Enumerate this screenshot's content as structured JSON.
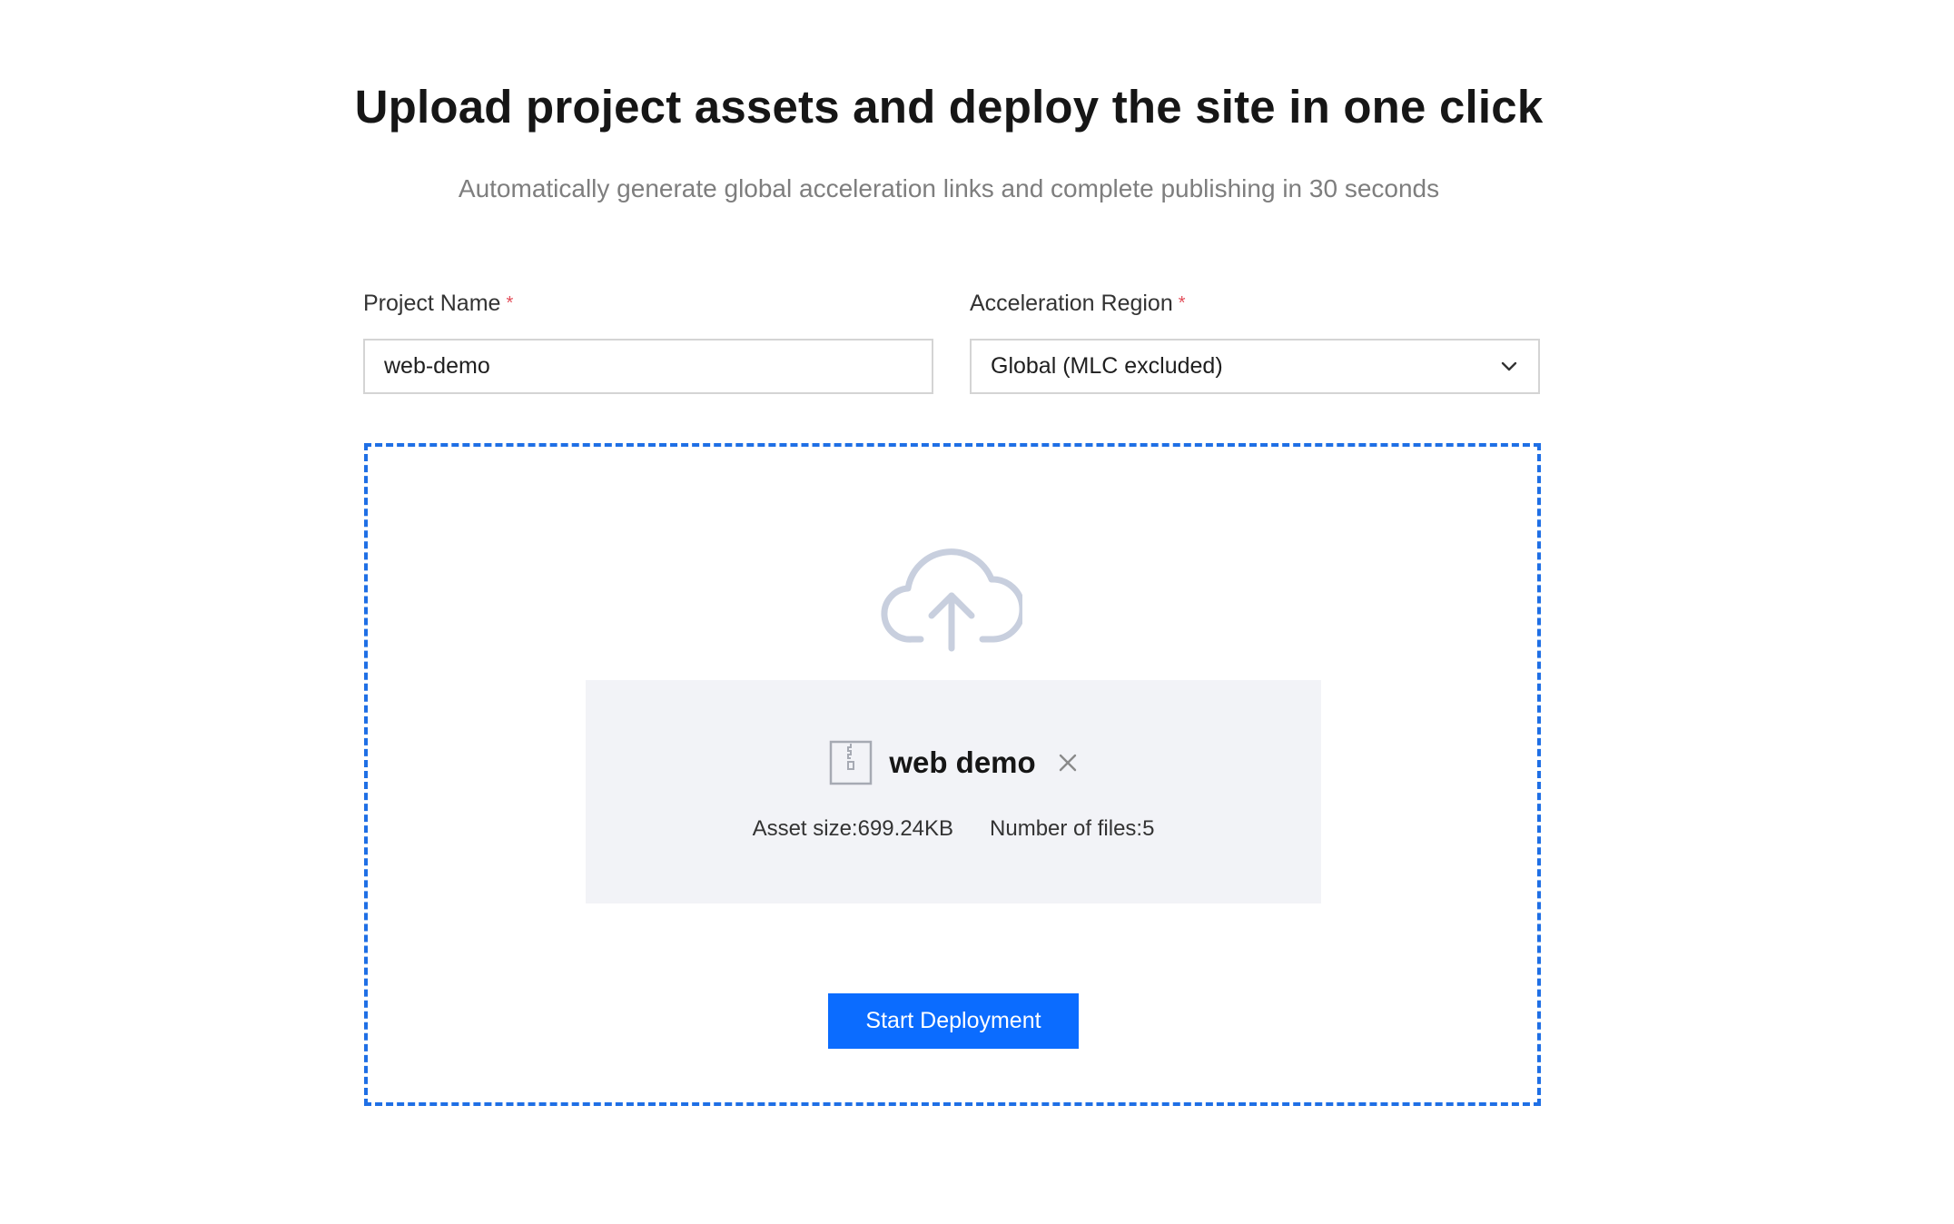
{
  "header": {
    "title": "Upload project assets and deploy the site in one click",
    "subtitle": "Automatically generate global acceleration links and complete publishing in 30 seconds"
  },
  "form": {
    "project_name": {
      "label": "Project Name",
      "required_mark": "*",
      "value": "web-demo"
    },
    "region": {
      "label": "Acceleration Region",
      "required_mark": "*",
      "selected": "Global (MLC excluded)"
    }
  },
  "upload": {
    "icon": "cloud-upload-icon",
    "file": {
      "icon": "zip-file-icon",
      "name": "web demo",
      "asset_size": "Asset size:699.24KB",
      "file_count": "Number of files:5"
    }
  },
  "actions": {
    "deploy_label": "Start Deployment"
  },
  "colors": {
    "accent": "#0b6cff",
    "dashed_border": "#1f6fe5",
    "required": "#e34d59",
    "card_bg": "#f2f3f7"
  }
}
